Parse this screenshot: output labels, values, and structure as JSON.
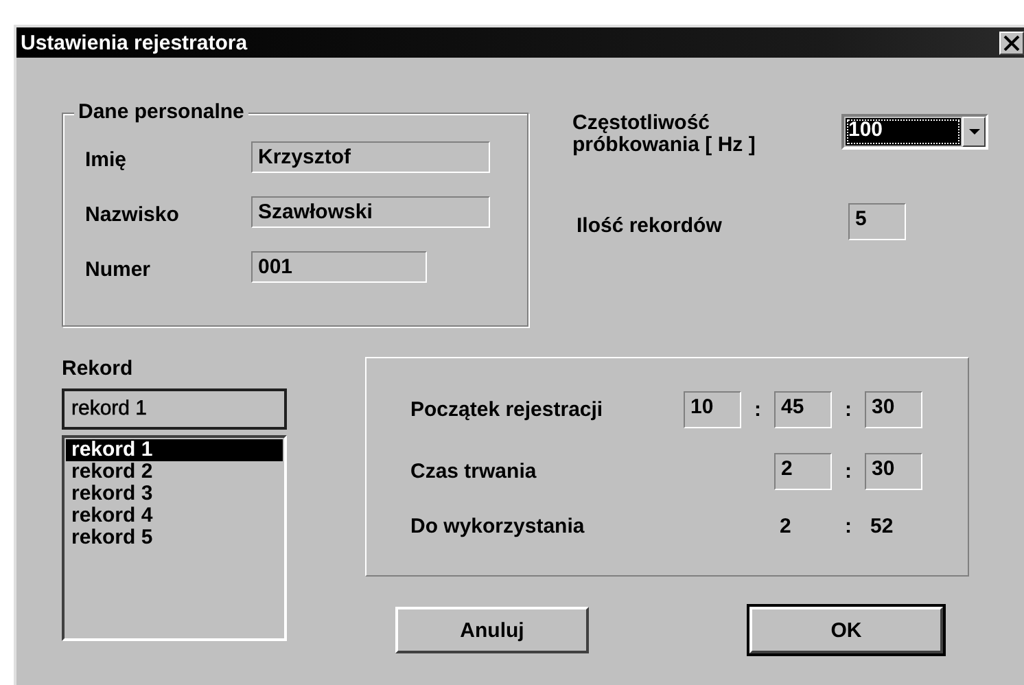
{
  "window": {
    "title": "Ustawienia rejestratora"
  },
  "personal": {
    "title": "Dane personalne",
    "fields": [
      {
        "label": "Imię",
        "value": "Krzysztof",
        "kind": "wide"
      },
      {
        "label": "Nazwisko",
        "value": "Szawłowski",
        "kind": "wide"
      },
      {
        "label": "Numer",
        "value": "001",
        "kind": "short"
      }
    ]
  },
  "sampling": {
    "label": "Częstotliwość próbkowania [ Hz ]",
    "value": "100"
  },
  "record_count": {
    "label": "Ilość rekordów",
    "value": "5"
  },
  "record": {
    "label": "Rekord",
    "value": "rekord 1",
    "items": [
      {
        "text": "rekord 1",
        "selected": true
      },
      {
        "text": "rekord 2",
        "selected": false
      },
      {
        "text": "rekord 3",
        "selected": false
      },
      {
        "text": "rekord 4",
        "selected": false
      },
      {
        "text": "rekord 5",
        "selected": false
      }
    ]
  },
  "timing": {
    "rows": [
      {
        "label": "Początek rejestracji",
        "kind": "input",
        "cells": [
          "10",
          ":",
          "45",
          ":",
          "30"
        ]
      },
      {
        "label": "Czas trwania",
        "kind": "input",
        "cells": [
          "",
          "",
          "2",
          ":",
          "30"
        ]
      },
      {
        "label": "Do wykorzystania",
        "kind": "readout",
        "cells": [
          "",
          "",
          "2",
          ":",
          "52"
        ]
      }
    ]
  },
  "buttons": [
    {
      "label": "Anuluj",
      "default": false
    },
    {
      "label": "OK",
      "default": true
    }
  ]
}
